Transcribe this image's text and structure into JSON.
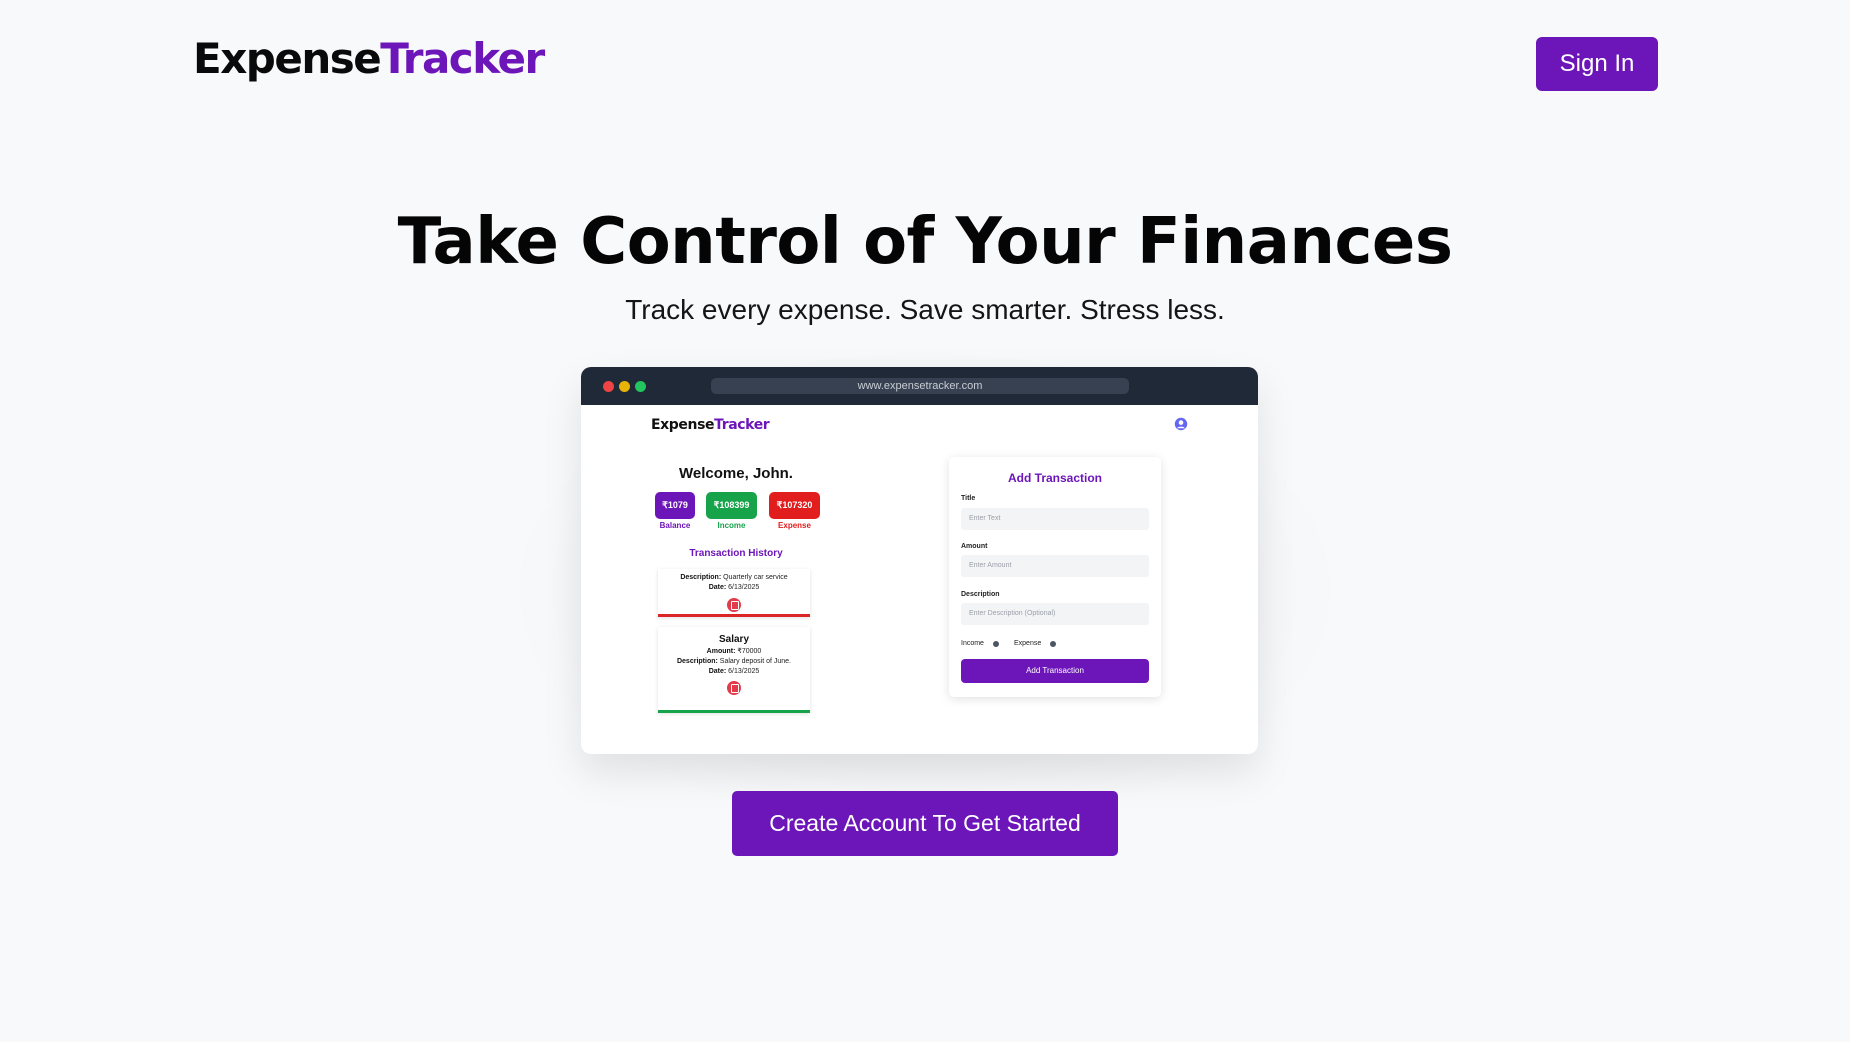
{
  "header": {
    "logo_part1": "Expense",
    "logo_part2": "Tracker",
    "signin_label": "Sign In"
  },
  "hero": {
    "title": "Take Control of Your Finances",
    "subtitle": "Track every expense. Save smarter. Stress less."
  },
  "preview": {
    "url": "www.expensetracker.com",
    "logo_part1": "Expense",
    "logo_part2": "Tracker",
    "user_icon": "user-circle-icon",
    "welcome": "Welcome, John.",
    "stats": [
      {
        "value": "₹1079",
        "label": "Balance",
        "color": "#6c15b8"
      },
      {
        "value": "₹108399",
        "label": "Income",
        "color": "#16a34a"
      },
      {
        "value": "₹107320",
        "label": "Expense",
        "color": "#e11d1d"
      }
    ],
    "history_title": "Transaction History",
    "transactions": [
      {
        "title": "",
        "description_label": "Description:",
        "description": "Quarterly car service",
        "date_label": "Date:",
        "date": "6/13/2025",
        "type_color": "#dc2626"
      },
      {
        "title": "Salary",
        "amount_label": "Amount:",
        "amount": "₹70000",
        "description_label": "Description:",
        "description": "Salary deposit of June.",
        "date_label": "Date:",
        "date": "6/13/2025",
        "type_color": "#16a34a"
      }
    ],
    "form": {
      "title": "Add Transaction",
      "title_label": "Title",
      "title_placeholder": "Enter Text",
      "amount_label": "Amount",
      "amount_placeholder": "Enter Amount",
      "description_label": "Description",
      "description_placeholder": "Enter Description (Optional)",
      "income_label": "Income",
      "expense_label": "Expense",
      "submit_label": "Add Transaction"
    }
  },
  "cta_label": "Create Account To Get Started",
  "colors": {
    "accent": "#6c15b8",
    "background": "#f8f9fb",
    "browser_bar": "#1f2937"
  }
}
